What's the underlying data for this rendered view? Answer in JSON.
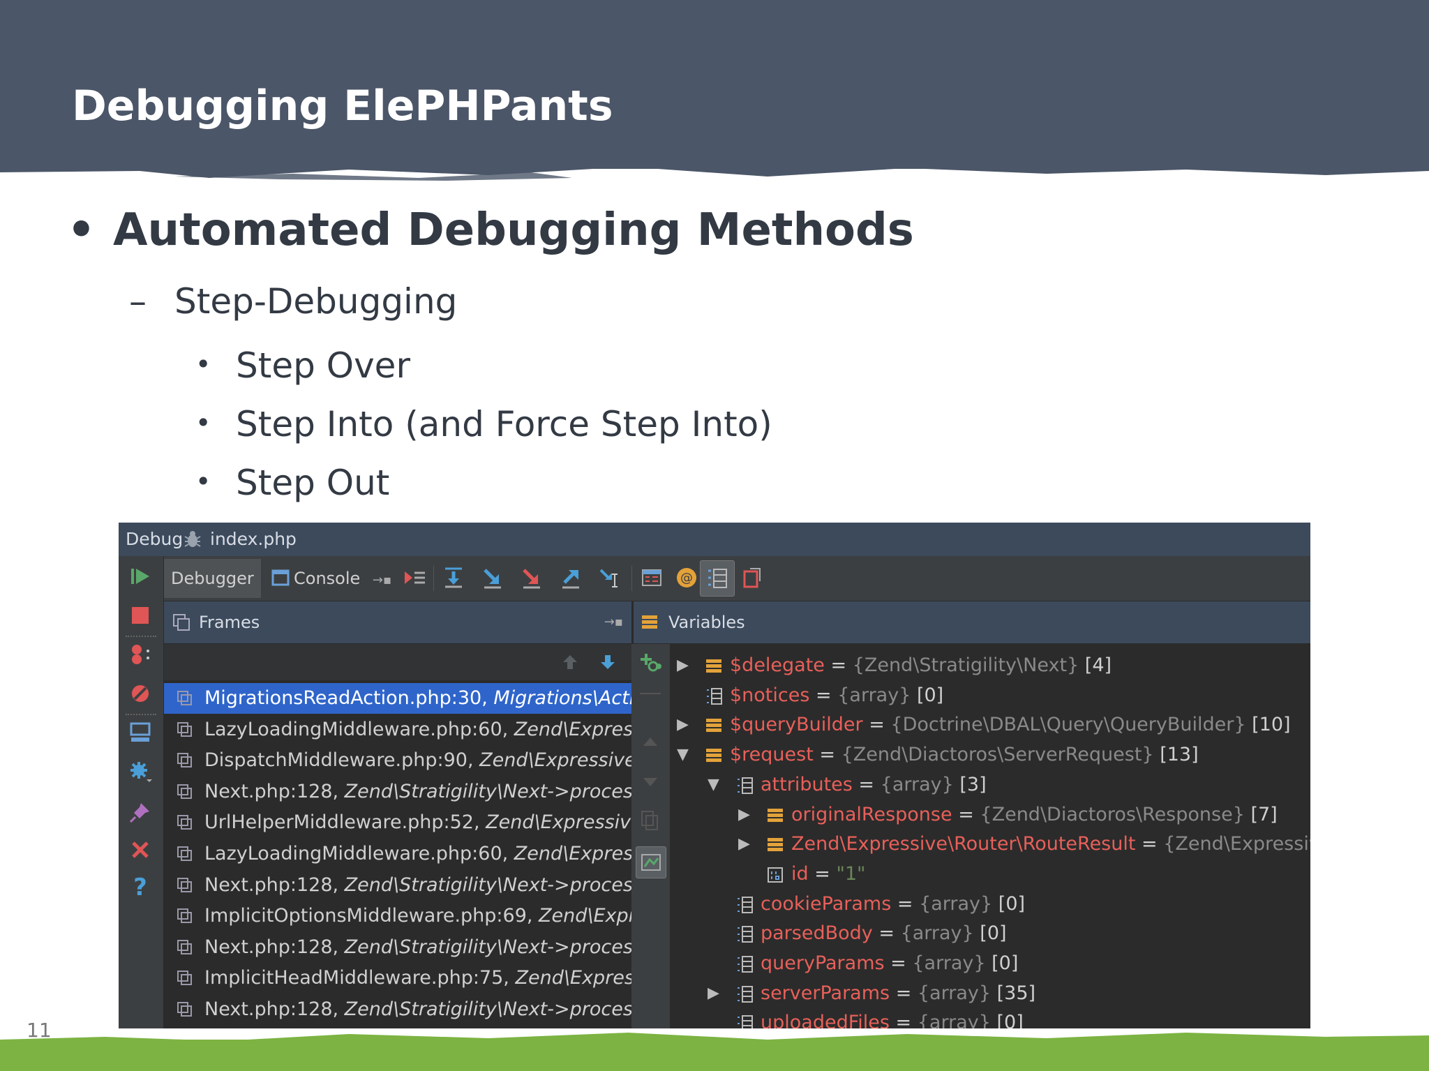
{
  "slide": {
    "title": "Debugging ElePHPants",
    "bullet1": "Automated Debugging Methods",
    "bullet2_marker": "–",
    "bullet2": "Step-Debugging",
    "bullet3": [
      "Step Over",
      "Step Into (and Force Step Into)",
      "Step Out"
    ],
    "bullet_dot": "•",
    "page_number": "11"
  },
  "ide": {
    "title_label": "Debug",
    "file_name": "index.php",
    "tabs": {
      "debugger": "Debugger",
      "console": "Console"
    },
    "frames_header": "Frames",
    "variables_header": "Variables",
    "frames": [
      {
        "file": "MigrationsReadAction.php:30, ",
        "method": "Migrations\\Action\\MigrationsReadAction->__invoke()"
      },
      {
        "file": "LazyLoadingMiddleware.php:60, ",
        "method": "Zend\\Expressive\\Middleware\\LazyLoadingMiddleware->process()"
      },
      {
        "file": "DispatchMiddleware.php:90, ",
        "method": "Zend\\Expressive\\Router\\Middleware\\DispatchMiddleware->process()"
      },
      {
        "file": "Next.php:128, ",
        "method": "Zend\\Stratigility\\Next->process()"
      },
      {
        "file": "UrlHelperMiddleware.php:52, ",
        "method": "Zend\\Expressive\\Helper\\UrlHelperMiddleware->process()"
      },
      {
        "file": "LazyLoadingMiddleware.php:60, ",
        "method": "Zend\\Expressive\\Middleware\\LazyLoadingMiddleware->process()"
      },
      {
        "file": "Next.php:128, ",
        "method": "Zend\\Stratigility\\Next->process()"
      },
      {
        "file": "ImplicitOptionsMiddleware.php:69, ",
        "method": "Zend\\Expressive\\Middleware\\ImplicitOptionsMiddleware->process()"
      },
      {
        "file": "Next.php:128, ",
        "method": "Zend\\Stratigility\\Next->process()"
      },
      {
        "file": "ImplicitHeadMiddleware.php:75, ",
        "method": "Zend\\Expressive\\Middleware\\ImplicitHeadMiddleware->process()"
      },
      {
        "file": "Next.php:128, ",
        "method": "Zend\\Stratigility\\Next->process()"
      }
    ],
    "variables": [
      {
        "name": "$delegate",
        "eq": " = ",
        "type": "{Zend\\Stratigility\\Next}",
        "count": " [4]"
      },
      {
        "name": "$notices",
        "eq": " = ",
        "type": "{array}",
        "count": " [0]"
      },
      {
        "name": "$queryBuilder",
        "eq": " = ",
        "type": "{Doctrine\\DBAL\\Query\\QueryBuilder}",
        "count": " [10]"
      },
      {
        "name": "$request",
        "eq": " = ",
        "type": "{Zend\\Diactoros\\ServerRequest}",
        "count": " [13]"
      },
      {
        "name": "attributes",
        "eq": " = ",
        "type": "{array}",
        "count": " [3]"
      },
      {
        "name": "originalResponse",
        "eq": " = ",
        "type": "{Zend\\Diactoros\\Response}",
        "count": " [7]"
      },
      {
        "name": "Zend\\Expressive\\Router\\RouteResult",
        "eq": " = ",
        "type": "{Zend\\Expressive\\Router\\RouteResult}",
        "count": ""
      },
      {
        "name": "id",
        "eq": " = ",
        "type": "",
        "count": "",
        "value": "\"1\""
      },
      {
        "name": "cookieParams",
        "eq": " = ",
        "type": "{array}",
        "count": " [0]"
      },
      {
        "name": "parsedBody",
        "eq": " = ",
        "type": "{array}",
        "count": " [0]"
      },
      {
        "name": "queryParams",
        "eq": " = ",
        "type": "{array}",
        "count": " [0]"
      },
      {
        "name": "serverParams",
        "eq": " = ",
        "type": "{array}",
        "count": " [35]"
      },
      {
        "name": "uploadedFiles",
        "eq": " = ",
        "type": "{array}",
        "count": " [0]"
      }
    ],
    "colors": {
      "variable_name": "#e8605a",
      "selected_frame": "#2f65ca",
      "resume_green": "#59a869",
      "stop_red": "#e05555"
    }
  }
}
